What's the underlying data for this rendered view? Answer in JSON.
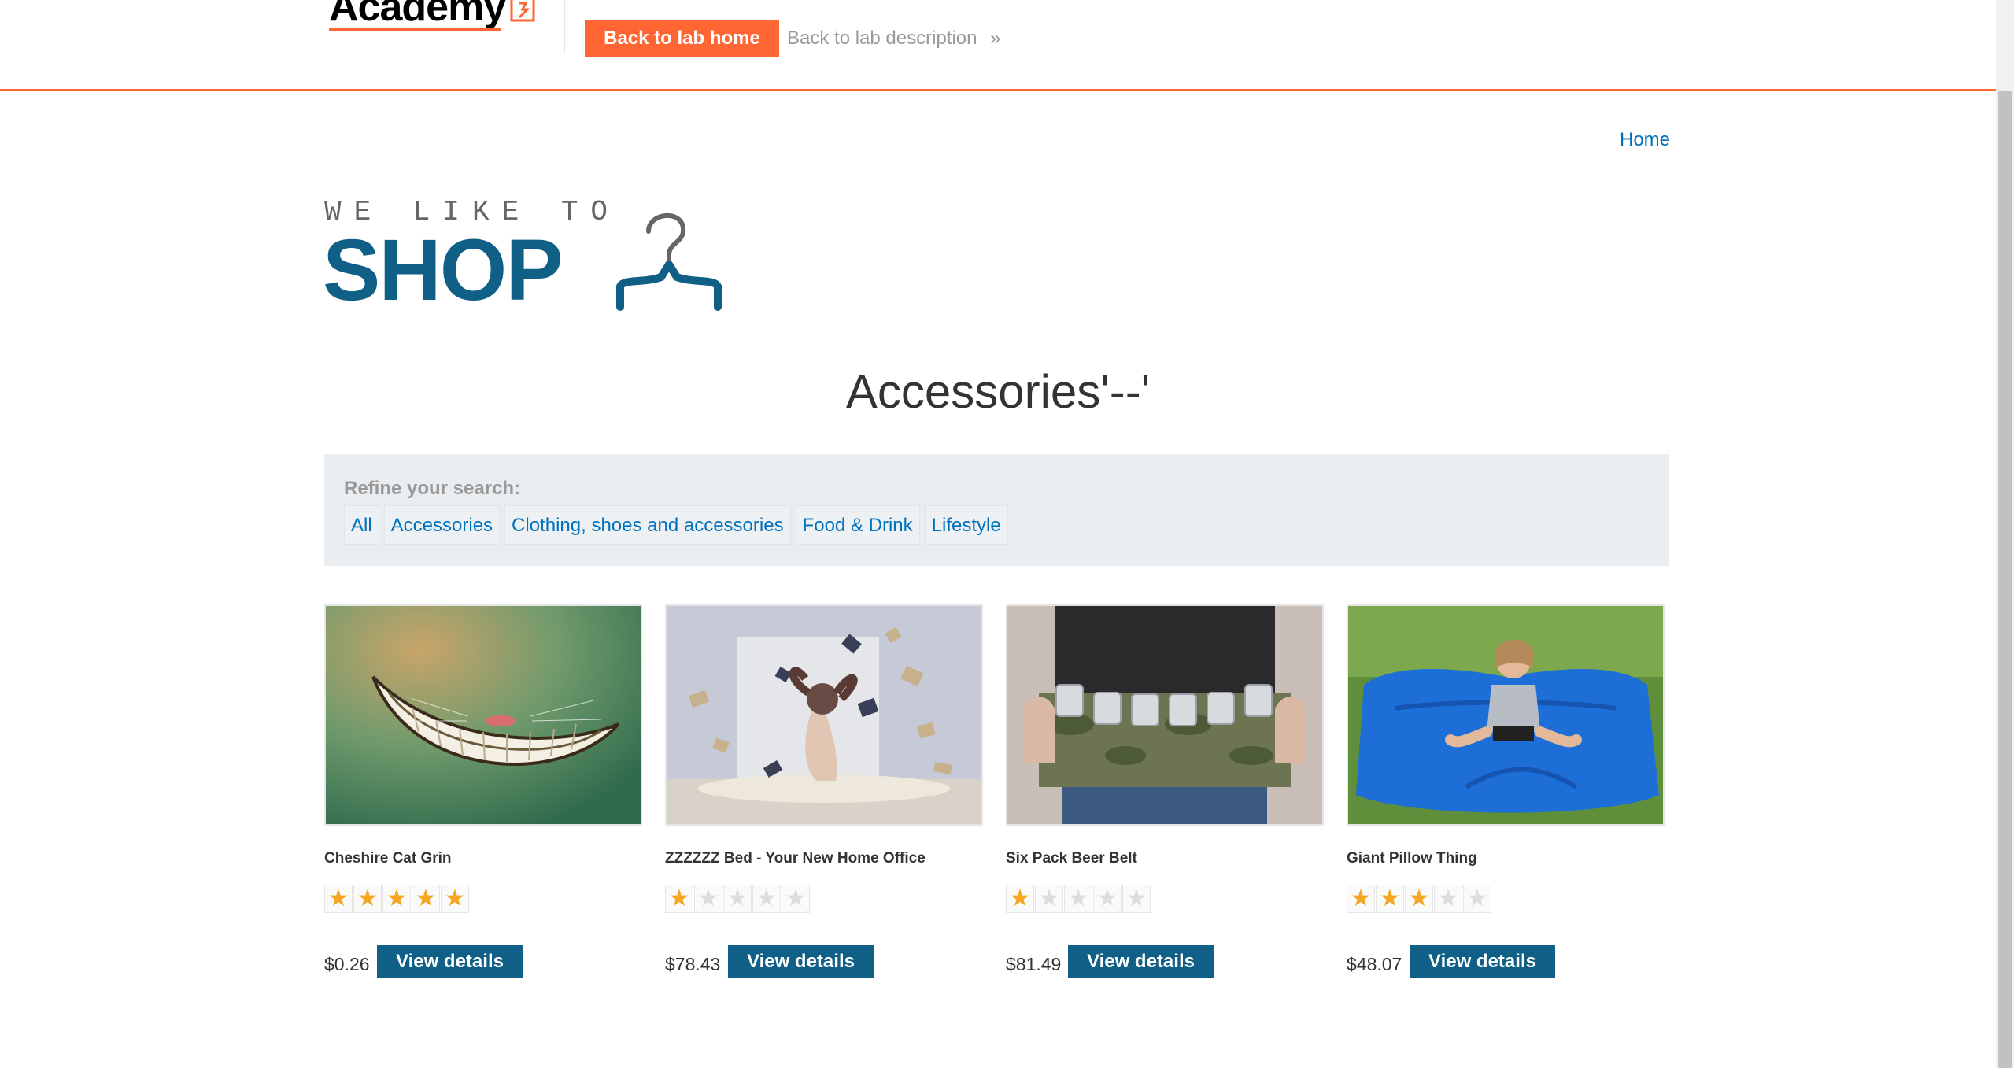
{
  "academy_header": {
    "logo_text": "Academy",
    "back_home_label": "Back to lab home",
    "back_description_label": "Back to lab description",
    "colors": {
      "accent": "#ff6633",
      "muted": "#999999"
    }
  },
  "shop": {
    "home_link": "Home",
    "logo_tagline": "WE LIKE TO",
    "logo_word": "SHOP",
    "page_title": "Accessories'--'",
    "filter": {
      "label": "Refine your search:",
      "categories": [
        "All",
        "Accessories",
        "Clothing, shoes and accessories",
        "Food & Drink",
        "Lifestyle"
      ]
    },
    "products": [
      {
        "name": "Cheshire Cat Grin",
        "rating": 5,
        "price": "$0.26",
        "button": "View details",
        "image": "cheshire-grin-image"
      },
      {
        "name": "ZZZZZZ Bed - Your New Home Office",
        "rating": 1,
        "price": "$78.43",
        "button": "View details",
        "image": "floating-books-bed-image"
      },
      {
        "name": "Six Pack Beer Belt",
        "rating": 1,
        "price": "$81.49",
        "button": "View details",
        "image": "beer-belt-image"
      },
      {
        "name": "Giant Pillow Thing",
        "rating": 3,
        "price": "$48.07",
        "button": "View details",
        "image": "giant-pillow-image"
      }
    ],
    "colors": {
      "brand": "#0f5f86",
      "link": "#0071bc",
      "star_on": "#f5a623",
      "star_off": "#dddddd",
      "filter_bg": "#e9edf0"
    }
  }
}
